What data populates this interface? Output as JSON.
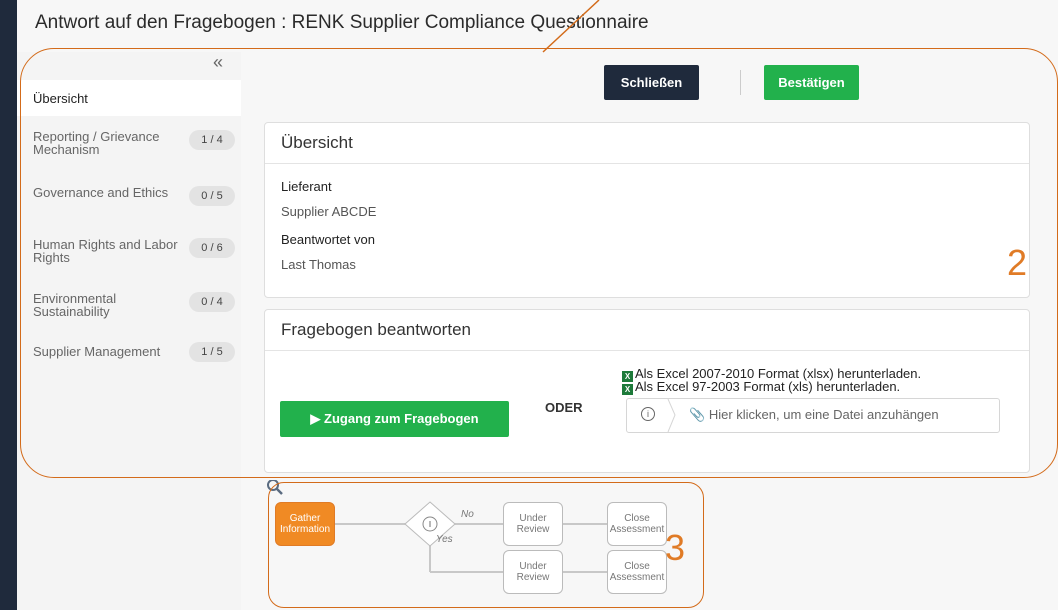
{
  "page": {
    "title": "Antwort auf den Fragebogen : RENK Supplier Compliance Questionnaire"
  },
  "sidebar": {
    "collapse_glyph": "«",
    "overview_label": "Übersicht",
    "items": [
      {
        "label": "Reporting / Grievance Mechanism",
        "count": "1 / 4"
      },
      {
        "label": "Governance and Ethics",
        "count": "0 / 5"
      },
      {
        "label": "Human Rights and Labor Rights",
        "count": "0 / 6"
      },
      {
        "label": "Environmental Sustainability",
        "count": "0 / 4"
      },
      {
        "label": "Supplier Management",
        "count": "1 / 5"
      }
    ]
  },
  "toolbar": {
    "close_label": "Schließen",
    "confirm_label": "Bestätigen"
  },
  "overview_card": {
    "title": "Übersicht",
    "supplier_label": "Lieferant",
    "supplier_value": "Supplier ABCDE",
    "answered_by_label": "Beantwortet von",
    "answered_by_value": "Last Thomas"
  },
  "answer_card": {
    "title": "Fragebogen beantworten",
    "access_button": "▶ Zugang zum Fragebogen",
    "or_label": "ODER",
    "download_xlsx": "Als Excel 2007-2010 Format (xlsx) herunterladen.",
    "download_xls": "Als Excel 97-2003 Format (xls) herunterladen.",
    "attach_placeholder": "Hier klicken, um eine Datei anzuhängen"
  },
  "workflow": {
    "nodes": {
      "gather": "Gather Information",
      "review1": "Under Review",
      "close1": "Close Assessment",
      "review2": "Under Review",
      "close2": "Close Assessment"
    },
    "no_label": "No",
    "yes_label": "Yes"
  },
  "annotations": {
    "two": "2",
    "three": "3"
  },
  "colors": {
    "accent_green": "#22b14c",
    "dark_navy": "#1f2a3c",
    "annotation_orange": "#e07b26",
    "active_node": "#f08a24"
  }
}
